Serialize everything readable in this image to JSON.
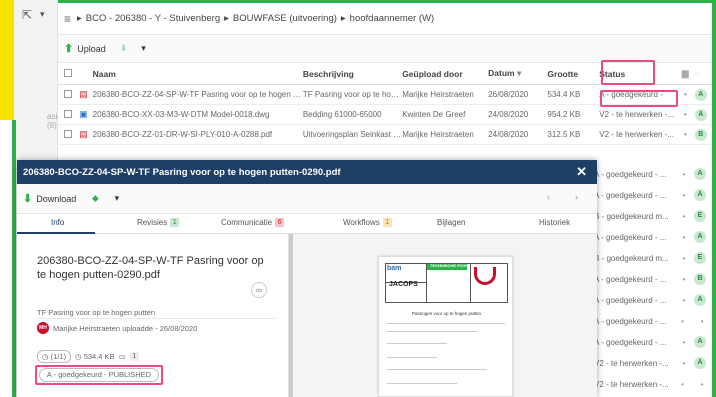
{
  "nav": {
    "pointer_icon": "pointer-icon",
    "ghost_text": "asie (8)"
  },
  "breadcrumb": [
    "BCO - 206380 - Y - Stuivenberg",
    "BOUWFASE (uitvoering)",
    "hoofdaannemer (W)"
  ],
  "toolbar": {
    "upload_label": "Upload"
  },
  "table": {
    "headers": {
      "name": "Naam",
      "desc": "Beschrijving",
      "uploader": "Geüpload door",
      "date": "Datum",
      "size": "Grootte",
      "status": "Status"
    },
    "rows": [
      {
        "name": "206380-BCO-ZZ-04-SP-W-TF Pasring voor op te hogen putte...",
        "desc": "TF Pasring voor op te hogen p...",
        "uploader": "Marijke Heirstraeten",
        "date": "26/08/2020",
        "size": "534.4 KB",
        "status": "A - goedgekeurd -",
        "badge": "A",
        "type": "pdf"
      },
      {
        "name": "206380-BCO-XX-03-M3-W-DTM Model-0018.dwg",
        "desc": "Bedding 61000-65000",
        "uploader": "Kwinten De Greef",
        "date": "24/08/2020",
        "size": "954.2 KB",
        "status": "V2 - te herwerken -...",
        "badge": "A",
        "type": "dwg"
      },
      {
        "name": "206380-BCO-ZZ-01-DR-W-SI-PLY-010-A-0288.pdf",
        "desc": "Uitvoeringsplan Seinkast 884B",
        "uploader": "Marijke Heirstraeten",
        "date": "24/08/2020",
        "size": "312.5 KB",
        "status": "V2 - te herwerken -...",
        "badge": "B",
        "type": "pdf"
      }
    ],
    "side_statuses": [
      {
        "status": "A - goedgekeurd - ...",
        "badge": "A"
      },
      {
        "status": "A - goedgekeurd - ...",
        "badge": "A"
      },
      {
        "status": "B - goedgekeurd m...",
        "badge": "E"
      },
      {
        "status": "A - goedgekeurd - ...",
        "badge": "A"
      },
      {
        "status": "B - goedgekeurd m...",
        "badge": "E"
      },
      {
        "status": "A - goedgekeurd - ...",
        "badge": "B"
      },
      {
        "status": "A - goedgekeurd - ...",
        "badge": "A"
      },
      {
        "status": "A - goedgekeurd - ...",
        "badge": ""
      },
      {
        "status": "A - goedgekeurd - ...",
        "badge": "A"
      },
      {
        "status": "V2 - te herwerken -...",
        "badge": "A"
      },
      {
        "status": "V2 - te herwerken -...",
        "badge": ""
      }
    ]
  },
  "overlay": {
    "title": "206380-BCO-ZZ-04-SP-W-TF Pasring voor op te hogen putten-0290.pdf",
    "close_icon": "close-icon",
    "download_label": "Download",
    "tabs": [
      {
        "label": "Info",
        "count": ""
      },
      {
        "label": "Revisies",
        "count": "1"
      },
      {
        "label": "Communicatie",
        "count": "6"
      },
      {
        "label": "Workflows",
        "count": "1"
      },
      {
        "label": "Bijlagen",
        "count": ""
      },
      {
        "label": "Historiek",
        "count": ""
      }
    ],
    "file_title": "206380-BCO-ZZ-04-SP-W-TF Pasring voor op te hogen putten-0290.pdf",
    "description": "TF Pasring voor op te hogen putten",
    "user_initials": "MH",
    "uploaded_by": "Marijke Heirstraeten uploadde - 26/08/2020",
    "revision_chip": "(1/1)",
    "size_chip": "534.4 KB",
    "attach_count": "1",
    "status_chip": "A - goedgekeurd - PUBLISHED",
    "doc": {
      "brand1": "bam",
      "brand2": "JACOPS",
      "header": "TECHNISCHE FICHE",
      "page_title": "Pasringen voor op te hogen putten"
    }
  }
}
